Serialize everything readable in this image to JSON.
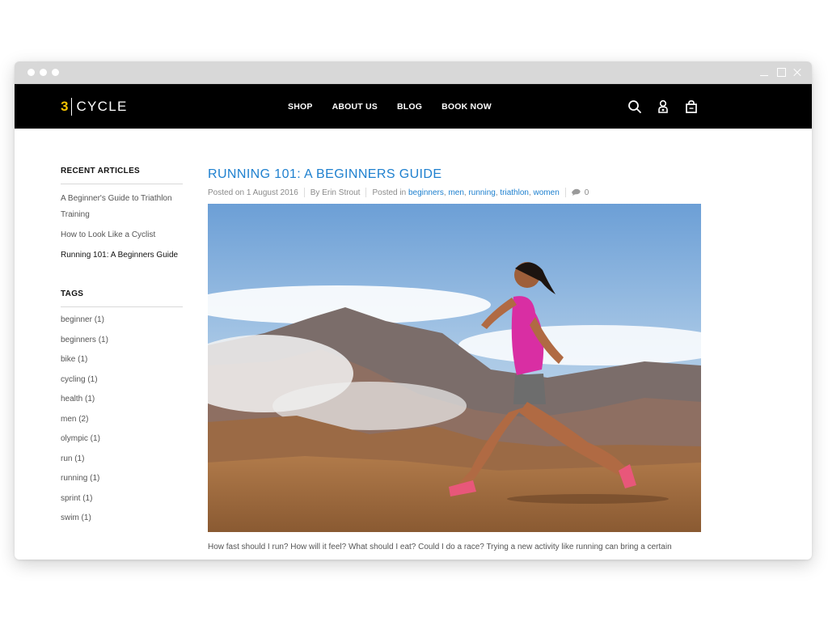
{
  "nav": {
    "logo_number": "3",
    "logo_text": "CYCLE",
    "links": [
      "SHOP",
      "ABOUT US",
      "BLOG",
      "BOOK NOW"
    ]
  },
  "sidebar": {
    "recent_heading": "RECENT ARTICLES",
    "recent_articles": [
      "A Beginner's Guide to Triathlon Training",
      "How to Look Like a Cyclist",
      "Running 101: A Beginners Guide"
    ],
    "tags_heading": "TAGS",
    "tags": [
      "beginner (1)",
      "beginners (1)",
      "bike (1)",
      "cycling (1)",
      "health (1)",
      "men (2)",
      "olympic (1)",
      "run (1)",
      "running (1)",
      "sprint (1)",
      "swim (1)"
    ]
  },
  "article": {
    "title": "RUNNING 101: A BEGINNERS GUIDE",
    "posted_on": "Posted on 1 August 2016",
    "author": "By Erin Strout",
    "posted_in_label": "Posted in",
    "categories": [
      "beginners",
      "men",
      "running",
      "triathlon",
      "women"
    ],
    "comment_count": "0",
    "excerpt": "How fast should I run? How will it feel? What should I eat? Could I do a race? Trying a new activity like running can bring a certain"
  },
  "colors": {
    "nav_bg": "#000000",
    "logo_accent": "#f2c200",
    "link_blue": "#1e80cf",
    "titlebar": "#d8d8d8"
  },
  "icons": [
    "search-icon",
    "account-icon",
    "cart-icon",
    "comment-icon"
  ]
}
